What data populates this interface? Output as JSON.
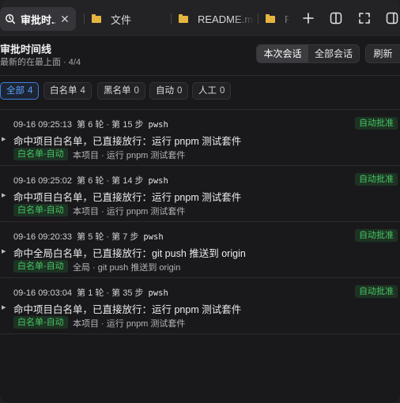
{
  "tabs": [
    {
      "label": "审批时...",
      "active": true
    },
    {
      "label": "文件"
    },
    {
      "label": "README.md"
    },
    {
      "label": "R"
    }
  ],
  "toolbar": {
    "new_tab": "+",
    "split": "split-view",
    "fullscreen": "expand"
  },
  "header": {
    "title": "审批时间线",
    "subtitle": "最新的在最上面 · 4/4",
    "scope_current": "本次会话",
    "scope_all": "全部会话",
    "refresh": "刷新"
  },
  "filters": [
    {
      "label": "全部",
      "count": "4",
      "active": true
    },
    {
      "label": "白名单",
      "count": "4"
    },
    {
      "label": "黑名单",
      "count": "0"
    },
    {
      "label": "自动",
      "count": "0"
    },
    {
      "label": "人工",
      "count": "0"
    }
  ],
  "entries": [
    {
      "time": "09-16 09:25:13",
      "round": "第 6 轮 · 第 15 步",
      "cmd": "pwsh",
      "status": "自动批准",
      "summary": "命中项目白名单，已直接放行：运行 pnpm 测试套件",
      "tag": "白名单-自动",
      "detail": "本项目 · 运行 pnpm 测试套件"
    },
    {
      "time": "09-16 09:25:02",
      "round": "第 6 轮 · 第 14 步",
      "cmd": "pwsh",
      "status": "自动批准",
      "summary": "命中项目白名单，已直接放行：运行 pnpm 测试套件",
      "tag": "白名单-自动",
      "detail": "本项目 · 运行 pnpm 测试套件"
    },
    {
      "time": "09-16 09:20:33",
      "round": "第 5 轮 · 第 7 步",
      "cmd": "pwsh",
      "status": "自动批准",
      "summary": "命中全局白名单，已直接放行：git push 推送到 origin",
      "tag": "白名单-自动",
      "detail": "全局 · git push 推送到 origin"
    },
    {
      "time": "09-16 09:03:04",
      "round": "第 1 轮 · 第 35 步",
      "cmd": "pwsh",
      "status": "自动批准",
      "summary": "命中项目白名单，已直接放行：运行 pnpm 测试套件",
      "tag": "白名单-自动",
      "detail": "本项目 · 运行 pnpm 测试套件"
    }
  ],
  "colors": {
    "accent": "#3f7fe0",
    "success": "#47c464",
    "folder": "#e5b540"
  }
}
